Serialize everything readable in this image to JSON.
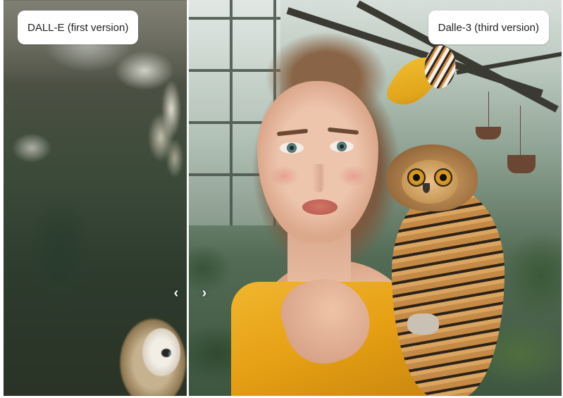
{
  "comparison": {
    "left_label": "DALL-E (first version)",
    "right_label": "Dalle-3 (third version)",
    "left_arrow_icon": "chevron-left-icon",
    "right_arrow_icon": "chevron-right-icon",
    "divider_color": "#f7f7f7"
  }
}
